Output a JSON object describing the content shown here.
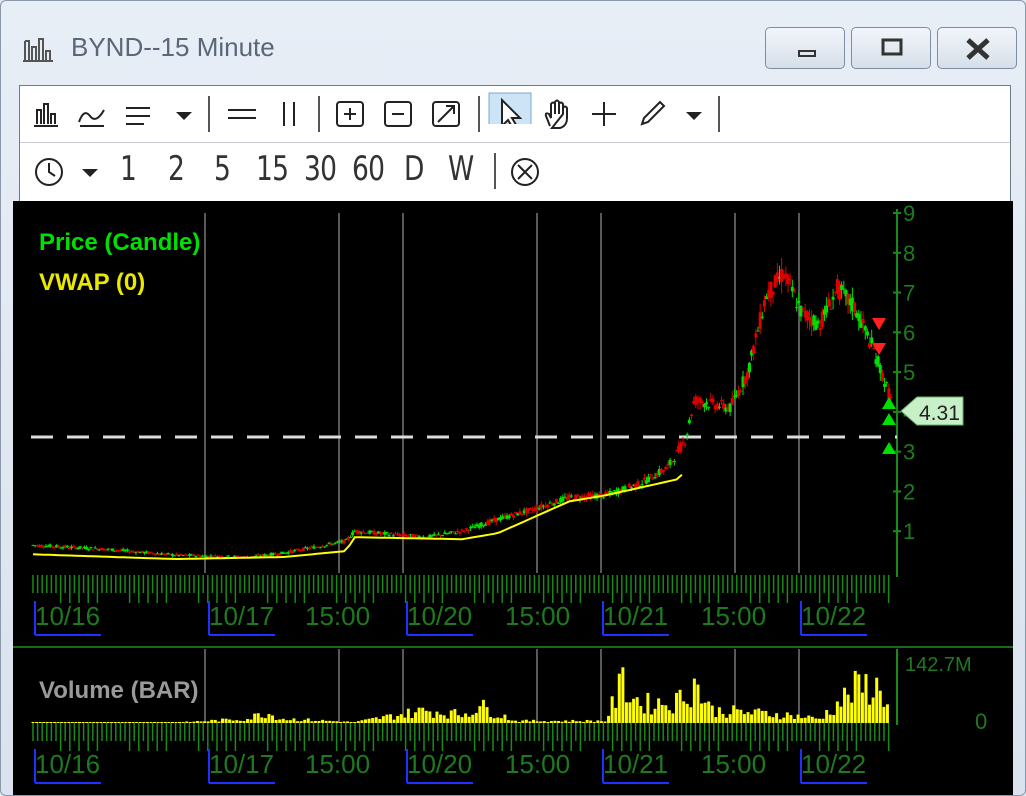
{
  "window": {
    "title": "BYND--15 Minute",
    "icon": "bar-chart-icon",
    "buttons": [
      "minimize-icon",
      "maximize-icon",
      "close-icon"
    ]
  },
  "toolbar1": {
    "icons": [
      "chart-type-icon",
      "indicator-icon",
      "studies-menu-icon",
      "dropdown-arrow-icon",
      "horizontal-line-icon",
      "vertical-line-icon",
      "zoom-in-icon",
      "zoom-out-icon",
      "zoom-fit-icon",
      "pointer-icon",
      "hand-icon",
      "crosshair-icon",
      "pencil-icon",
      "dropdown-arrow-icon"
    ]
  },
  "toolbar2": {
    "timeframes": [
      "1",
      "2",
      "5",
      "15",
      "30",
      "60",
      "D",
      "W"
    ],
    "icons": [
      "clock-icon",
      "dropdown-arrow-icon",
      "cancel-icon"
    ]
  },
  "price_panel": {
    "legend_price": "Price (Candle)",
    "legend_vwap": "VWAP (0)",
    "current_price": "4.31",
    "price_color": "#00ff00",
    "vwap_color": "#ffff00"
  },
  "volume_panel": {
    "legend": "Volume (BAR)",
    "max_label": "142.7M",
    "zero_label": "0"
  },
  "chart_data": {
    "type": "candlestick",
    "yticks": [
      "1",
      "2",
      "3",
      "4",
      "5",
      "6",
      "7",
      "8",
      "9"
    ],
    "ylim": [
      0,
      9
    ],
    "xlabels": [
      "10/16",
      "10/17",
      "15:00",
      "10/20",
      "15:00",
      "10/21",
      "15:00",
      "10/22"
    ],
    "price_path": [
      [
        0,
        0.65
      ],
      [
        4,
        0.55
      ],
      [
        8,
        0.4
      ],
      [
        12,
        0.35
      ],
      [
        14,
        0.45
      ],
      [
        17.5,
        0.75
      ],
      [
        18,
        1.0
      ],
      [
        22,
        0.85
      ],
      [
        24,
        1.0
      ],
      [
        26,
        1.3
      ],
      [
        28,
        1.55
      ],
      [
        30,
        1.85
      ],
      [
        32,
        1.9
      ],
      [
        34,
        2.2
      ],
      [
        35.5,
        2.6
      ],
      [
        36.5,
        3.3
      ],
      [
        37,
        4.3
      ],
      [
        39,
        4.1
      ],
      [
        40,
        5.0
      ],
      [
        41,
        6.9
      ],
      [
        42,
        7.5
      ],
      [
        43,
        6.5
      ],
      [
        44,
        6.2
      ],
      [
        45,
        7.1
      ],
      [
        46,
        6.6
      ],
      [
        47,
        5.6
      ],
      [
        48,
        4.3
      ]
    ],
    "vwap_path": [
      [
        0,
        0.42
      ],
      [
        8,
        0.3
      ],
      [
        14,
        0.35
      ],
      [
        17.5,
        0.5
      ],
      [
        18,
        0.85
      ],
      [
        24,
        0.8
      ],
      [
        26,
        0.95
      ],
      [
        30,
        1.75
      ],
      [
        32,
        1.9
      ],
      [
        34,
        2.1
      ],
      [
        36,
        2.3
      ],
      [
        36.5,
        2.5
      ]
    ],
    "volume": [
      [
        0,
        0.01
      ],
      [
        8,
        0.01
      ],
      [
        12,
        0.1
      ],
      [
        13,
        0.25
      ],
      [
        14,
        0.1
      ],
      [
        18,
        0.02
      ],
      [
        22,
        0.3
      ],
      [
        24,
        0.2
      ],
      [
        25,
        0.4
      ],
      [
        27,
        0.05
      ],
      [
        32,
        0.05
      ],
      [
        33,
        0.95
      ],
      [
        34,
        0.45
      ],
      [
        36,
        0.5
      ],
      [
        37,
        0.95
      ],
      [
        38,
        0.3
      ],
      [
        40,
        0.25
      ],
      [
        42,
        0.2
      ],
      [
        44,
        0.1
      ],
      [
        46,
        0.8
      ],
      [
        47,
        0.9
      ],
      [
        48,
        0.5
      ]
    ]
  }
}
